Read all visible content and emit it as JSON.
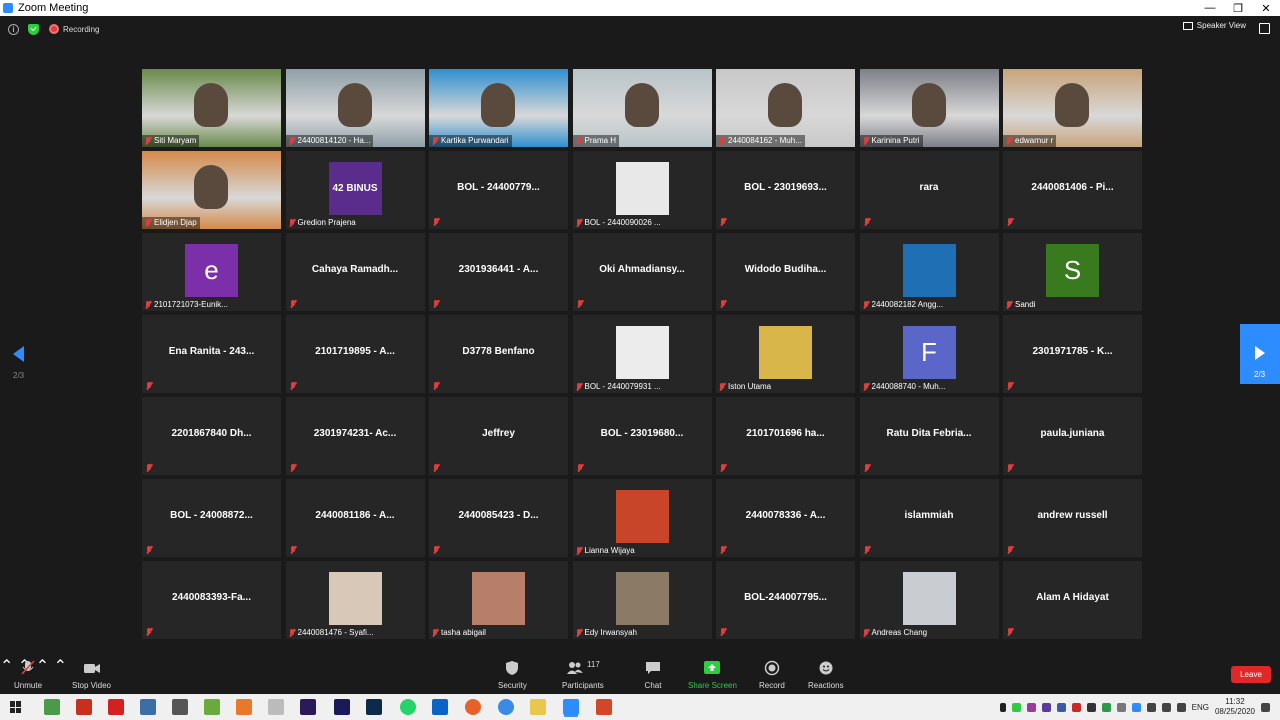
{
  "window": {
    "title": "Zoom Meeting",
    "minimize": "—",
    "restore": "❐",
    "close": "✕"
  },
  "topbar": {
    "recording_label": "Recording",
    "view_label": "Speaker View"
  },
  "nav": {
    "page_indicator": "2/3"
  },
  "participants": [
    {
      "label": "Siti Maryam",
      "video": true,
      "bg": "#6a8a4a"
    },
    {
      "label": "24400814120 - Ha...",
      "video": true,
      "bg": "#8fa0a8"
    },
    {
      "label": "Kartika Purwandari",
      "video": true,
      "bg": "#2f8fd0"
    },
    {
      "label": "Prama H",
      "video": true,
      "bg": "#b9c4c8"
    },
    {
      "label": "2440084162 - Muh...",
      "video": true,
      "bg": "#c8c8c8"
    },
    {
      "label": "Karinina Putri",
      "video": true,
      "bg": "#7d7f88"
    },
    {
      "label": "edwarnur r",
      "video": true,
      "bg": "#c9a47a"
    },
    {
      "label": "Elidjen Djap",
      "video": true,
      "bg": "#d48a4a"
    },
    {
      "label": "Gredion Prajena",
      "thumb": "#5a2d8c",
      "thumb_text": "42 BINUS"
    },
    {
      "name": "BOL - 24400779..."
    },
    {
      "label": "BOL - 2440090026 ...",
      "thumb": "#e8e8e8"
    },
    {
      "name": "BOL - 23019693..."
    },
    {
      "name": "rara"
    },
    {
      "name": "2440081406 - Pi..."
    },
    {
      "label": "2101721073-Eunik...",
      "avatar": "e",
      "avatar_color": "#7b2fa8"
    },
    {
      "name": "Cahaya  Ramadh..."
    },
    {
      "name": "2301936441 - A..."
    },
    {
      "name": "Oki  Ahmadiansy..."
    },
    {
      "name": "Widodo  Budiha..."
    },
    {
      "label": "2440082182 Angg...",
      "thumb": "#1f6fb5"
    },
    {
      "label": "Sandi",
      "avatar": "S",
      "avatar_color": "#3a7a1f"
    },
    {
      "name": "Ena Ranita - 243..."
    },
    {
      "name": "2101719895 - A..."
    },
    {
      "name": "D3778 Benfano"
    },
    {
      "label": "BOL - 2440079931 ...",
      "thumb": "#ececec"
    },
    {
      "label": "Iston Utama",
      "thumb": "#d9b64a"
    },
    {
      "label": "2440088740 - Muh...",
      "avatar": "F",
      "avatar_color": "#5b66c9"
    },
    {
      "name": "2301971785 - K..."
    },
    {
      "name": "2201867840 Dh..."
    },
    {
      "name": "2301974231- Ac..."
    },
    {
      "name": "Jeffrey"
    },
    {
      "name": "BOL - 23019680..."
    },
    {
      "name": "2101701696 ha..."
    },
    {
      "name": "Ratu  Dita  Febria..."
    },
    {
      "name": "paula.juniana"
    },
    {
      "name": "BOL - 24008872..."
    },
    {
      "name": "2440081186 - A..."
    },
    {
      "name": "2440085423 - D..."
    },
    {
      "label": "Lianna Wijaya",
      "thumb": "#c8452a"
    },
    {
      "name": "2440078336 - A..."
    },
    {
      "name": "islammiah"
    },
    {
      "name": "andrew russell"
    },
    {
      "name": "2440083393-Fa..."
    },
    {
      "label": "2440081476 - Syafi...",
      "thumb": "#d7c8b8"
    },
    {
      "label": "tasha abigail",
      "thumb": "#b77f6a"
    },
    {
      "label": "Edy Irwansyah",
      "thumb": "#8b7a66"
    },
    {
      "name": "BOL-244007795..."
    },
    {
      "label": "Andreas Chang",
      "thumb": "#c9ccd0"
    },
    {
      "name": "Alam A Hidayat"
    }
  ],
  "toolbar": {
    "unmute": "Unmute",
    "stop_video": "Stop Video",
    "security": "Security",
    "participants": "Participants",
    "participant_count": "117",
    "chat": "Chat",
    "share_screen": "Share Screen",
    "record": "Record",
    "reactions": "Reactions",
    "leave": "Leave"
  },
  "taskbar": {
    "language": "ENG",
    "time": "11:32",
    "date": "08/25/2020"
  }
}
